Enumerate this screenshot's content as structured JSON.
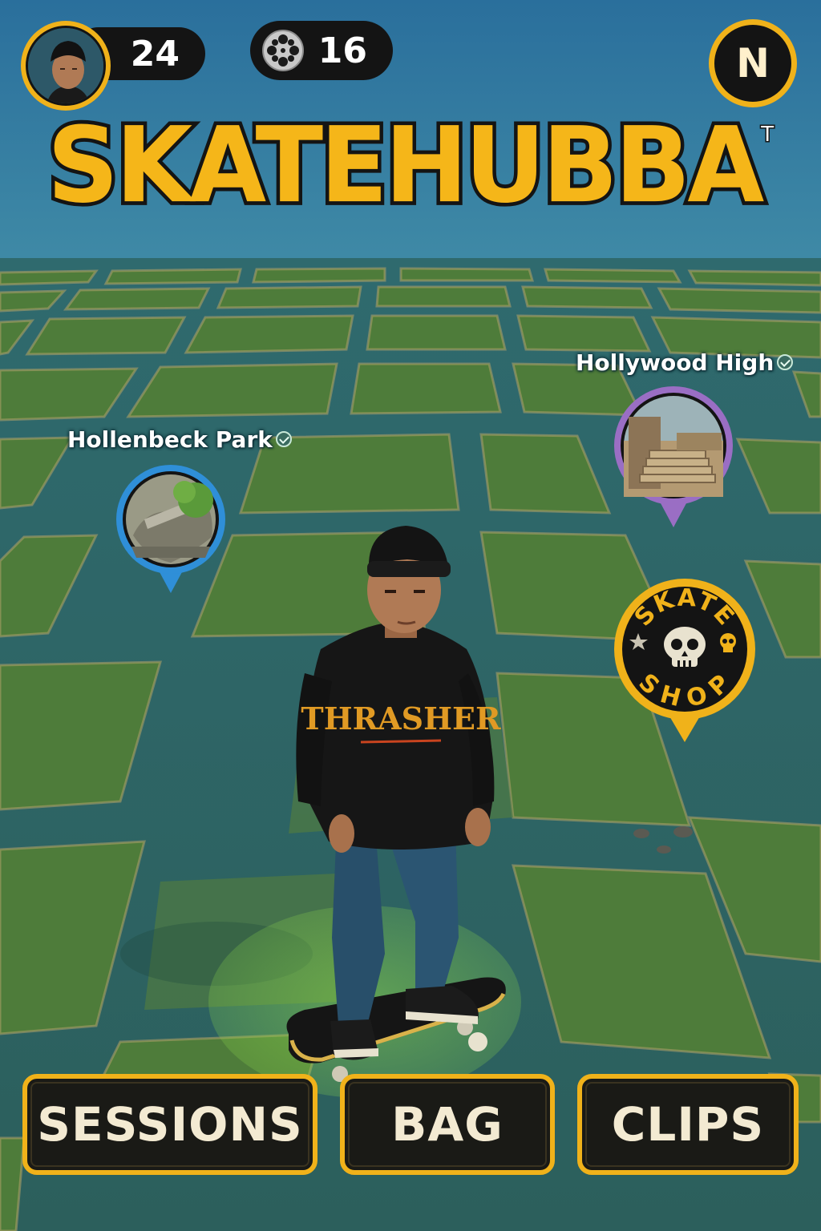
{
  "app": {
    "title": "SKATEHUBBA",
    "trademark": "T"
  },
  "hud": {
    "level": "24",
    "clips_count": "16",
    "compass_label": "N"
  },
  "spots": [
    {
      "name": "Hollenbeck Park",
      "verified": true,
      "ring_color": "#2f8fd8"
    },
    {
      "name": "Hollywood High",
      "verified": true,
      "ring_color": "#9a6ec4"
    }
  ],
  "shop": {
    "line1": "SKATE",
    "line2": "SHOP",
    "ring_color": "#f0b21a"
  },
  "player": {
    "hoodie_text": "THRASHER"
  },
  "nav": {
    "sessions": "SESSIONS",
    "bag": "BAG",
    "clips": "CLIPS"
  },
  "colors": {
    "accent": "#f0b21a",
    "sky": "#2c6f9a",
    "grass": "#4f7f3c",
    "road": "#2f6468"
  }
}
